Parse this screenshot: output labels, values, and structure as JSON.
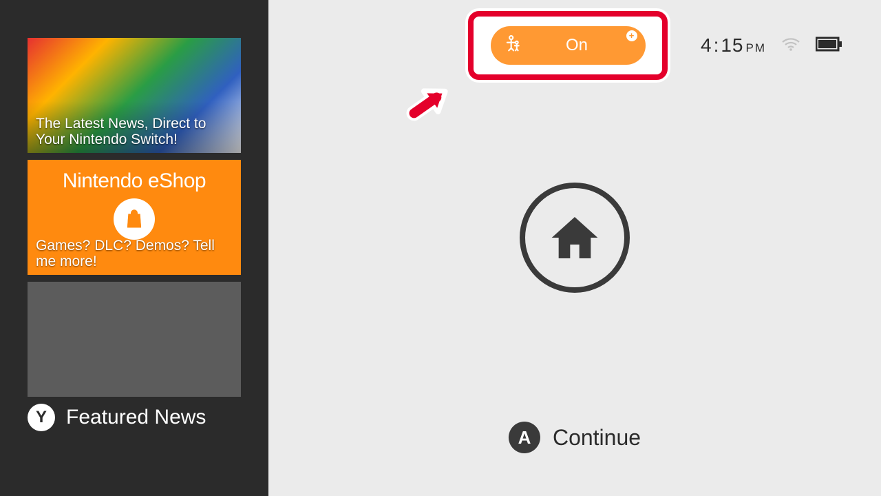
{
  "sidebar": {
    "news": [
      {
        "caption": "The Latest News, Direct to Your Nintendo Switch!"
      },
      {
        "logo": "Nintendo eShop",
        "caption": "Games? DLC? Demos? Tell me more!"
      },
      {
        "caption": ""
      }
    ],
    "featured_button_glyph": "Y",
    "featured_label": "Featured News"
  },
  "main": {
    "parental_toggle_label": "On",
    "clock_time": "4",
    "clock_minutes": "15",
    "clock_ampm": "PM",
    "continue_glyph": "A",
    "continue_label": "Continue"
  },
  "colors": {
    "accent_red": "#e4002b",
    "accent_orange": "#ff9933",
    "eshop_orange": "#ff8a0f"
  }
}
